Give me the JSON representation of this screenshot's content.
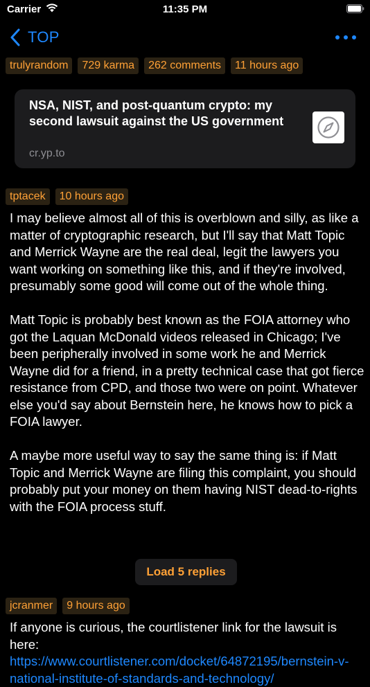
{
  "status_bar": {
    "carrier": "Carrier",
    "time": "11:35 PM",
    "icons": [
      "wifi-icon",
      "battery-icon"
    ]
  },
  "nav": {
    "back_label": "TOP",
    "back_icon": "chevron-left-icon",
    "more_icon": "more-ellipsis-icon",
    "accent_color": "#1e88ff"
  },
  "post": {
    "author": "trulyrandom",
    "karma": "729 karma",
    "comments": "262 comments",
    "time": "11 hours ago",
    "link": {
      "title": "NSA, NIST, and post-quantum crypto: my second lawsuit against the US government",
      "domain": "cr.yp.to",
      "icon": "safari-compass-icon"
    }
  },
  "comments": [
    {
      "author": "tptacek",
      "time": "10 hours ago",
      "paragraphs": [
        "I may believe almost all of this is overblown and silly, as like a matter of cryptographic research, but I'll say that Matt Topic and Merrick Wayne are the real deal, legit the lawyers you want working on something like this, and if they're involved, presumably some good will come out of the whole thing.",
        "Matt Topic is probably best known as the FOIA attorney who got the Laquan McDonald videos released in Chicago; I've been peripherally involved in some work he and Merrick Wayne did for a friend, in a pretty technical case that got fierce resistance from CPD, and those two were on point. Whatever else you'd say about Bernstein here, he knows how to pick a FOIA lawyer.",
        "A maybe more useful way to say the same thing is: if Matt Topic and Merrick Wayne are filing this complaint, you should probably put your money on them having NIST dead-to-rights with the FOIA process stuff."
      ],
      "load_replies": "Load 5 replies"
    },
    {
      "author": "jcranmer",
      "time": "9 hours ago",
      "text_before_link": "If anyone is curious, the courtlistener link for the lawsuit is here: ",
      "link_text": "https://www.courtlistener.com/docket/64872195/bernstein-v-national-institute-of-standards-and-technology/"
    }
  ],
  "colors": {
    "tag_text": "#ffa136",
    "tag_bg": "#2b2213",
    "card_bg": "#1c1c1e",
    "link": "#1e88ff"
  }
}
